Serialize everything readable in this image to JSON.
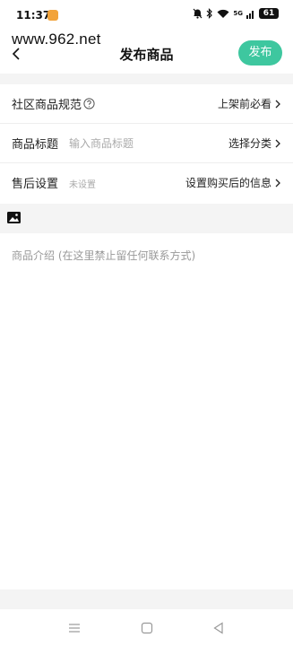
{
  "status_bar": {
    "time": "11:37",
    "network": "5G",
    "battery": "61"
  },
  "watermark": "www.962.net",
  "header": {
    "title": "发布商品",
    "publish_label": "发布"
  },
  "rows": {
    "rules": {
      "label": "社区商品规范",
      "action": "上架前必看"
    },
    "title": {
      "label": "商品标题",
      "placeholder": "输入商品标题",
      "action": "选择分类"
    },
    "after_sale": {
      "label": "售后设置",
      "status": "未设置",
      "action": "设置购买后的信息"
    }
  },
  "description_placeholder": "商品介绍 (在这里禁止留任何联系方式)",
  "colors": {
    "accent": "#3ec79f",
    "band": "#f4f4f4"
  },
  "icons": [
    "back-icon",
    "help-icon",
    "chevron-right-icon",
    "image-icon",
    "menu-icon",
    "home-icon",
    "back-triangle-icon"
  ]
}
